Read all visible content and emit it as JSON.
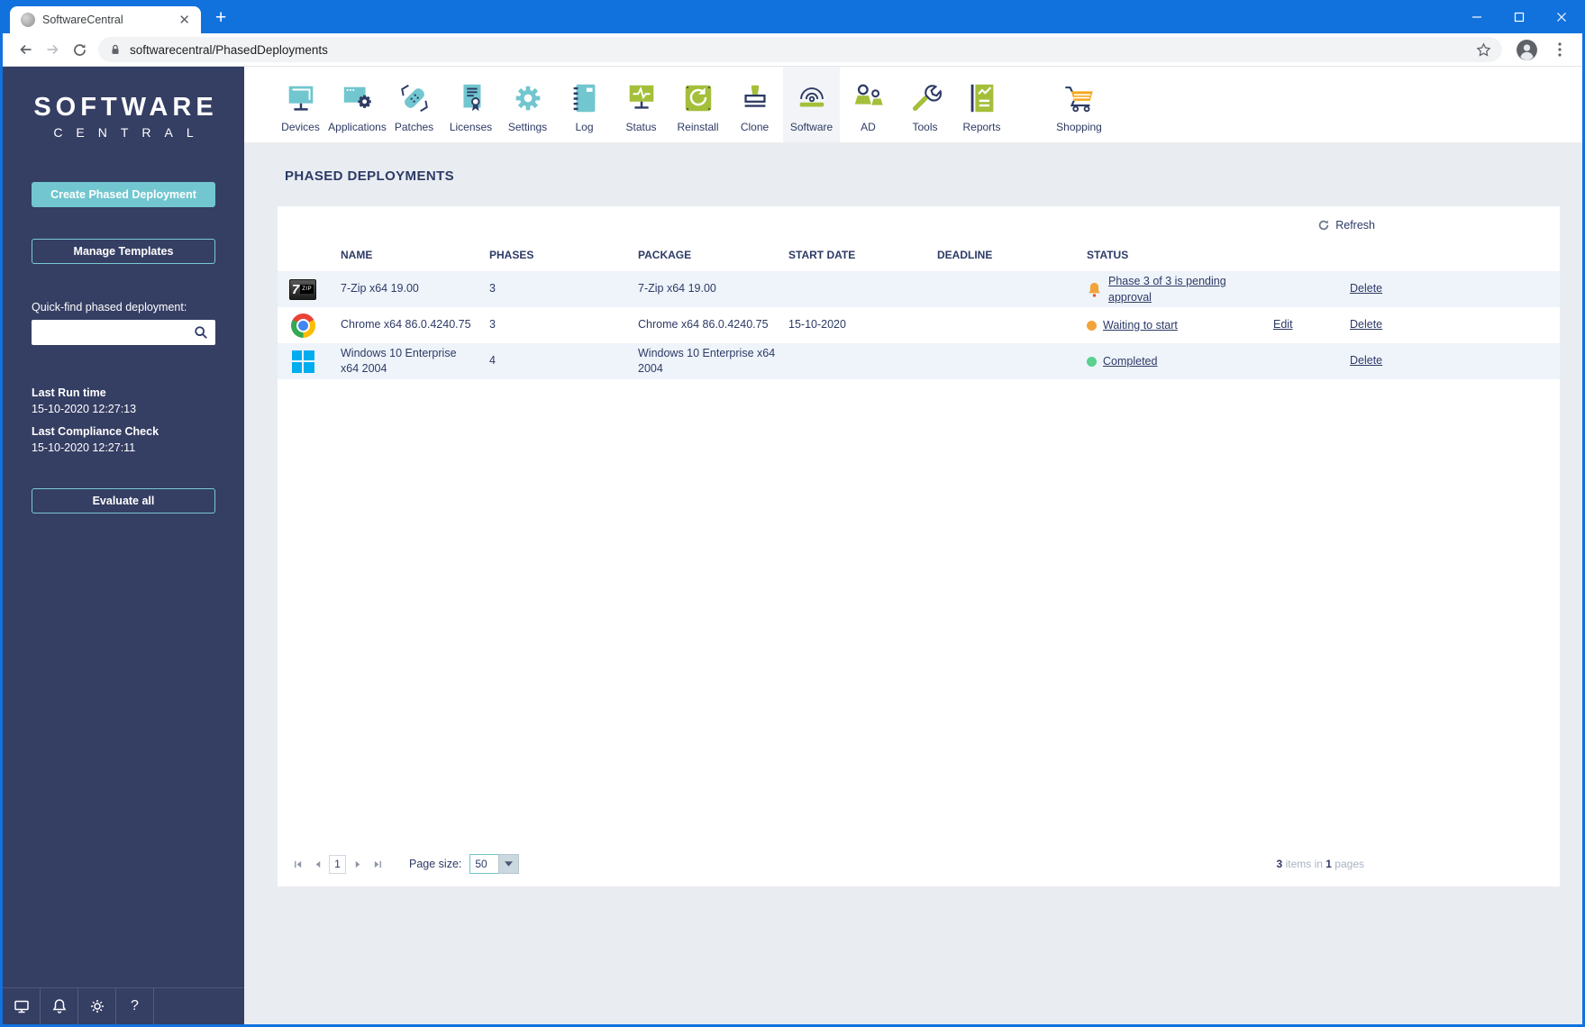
{
  "colors": {
    "titlebar": "#1172de",
    "sidebar": "#353e63",
    "teal": "#71c6cf",
    "olive": "#a4bf3a",
    "navy": "#2d3a64",
    "orange": "#f2a43c",
    "green": "#5bd08f",
    "main_bg": "#e9edf2",
    "alt_row": "#eff4fa",
    "windows_blue": "#00adef"
  },
  "browser": {
    "tab_title": "SoftwareCentral",
    "url": "softwarecentral/PhasedDeployments"
  },
  "sidebar": {
    "logo_line1": "SOFTWARE",
    "logo_line2": "CENTRAL",
    "create_button": "Create Phased Deployment",
    "manage_button": "Manage Templates",
    "quickfind_label": "Quick-find phased deployment:",
    "quickfind_value": "",
    "last_run_label": "Last Run time",
    "last_run_value": "15-10-2020 12:27:13",
    "last_compliance_label": "Last Compliance Check",
    "last_compliance_value": "15-10-2020 12:27:11",
    "evaluate_button": "Evaluate all"
  },
  "nav": {
    "items": [
      {
        "label": "Devices",
        "icon": "devices"
      },
      {
        "label": "Applications",
        "icon": "applications"
      },
      {
        "label": "Patches",
        "icon": "patches"
      },
      {
        "label": "Licenses",
        "icon": "licenses"
      },
      {
        "label": "Settings",
        "icon": "settings"
      },
      {
        "label": "Log",
        "icon": "log"
      },
      {
        "label": "Status",
        "icon": "status"
      },
      {
        "label": "Reinstall",
        "icon": "reinstall"
      },
      {
        "label": "Clone",
        "icon": "clone"
      },
      {
        "label": "Software",
        "icon": "software",
        "active": true
      },
      {
        "label": "AD",
        "icon": "ad"
      },
      {
        "label": "Tools",
        "icon": "tools"
      },
      {
        "label": "Reports",
        "icon": "reports"
      },
      {
        "label": "Shopping",
        "icon": "shopping",
        "gap": true
      }
    ]
  },
  "main": {
    "title": "PHASED DEPLOYMENTS",
    "refresh_label": "Refresh",
    "table": {
      "columns": [
        "NAME",
        "PHASES",
        "PACKAGE",
        "START DATE",
        "DEADLINE",
        "STATUS"
      ],
      "rows": [
        {
          "icon": "sevenzip",
          "name": "7-Zip x64 19.00",
          "phases": "3",
          "package": "7-Zip x64 19.00",
          "start_date": "",
          "deadline": "",
          "status_text": "Phase 3 of 3 is pending approval",
          "status_icon": "bell",
          "edit_label": "",
          "delete_label": "Delete"
        },
        {
          "icon": "chrome",
          "name": "Chrome x64 86.0.4240.75",
          "phases": "3",
          "package": "Chrome x64 86.0.4240.75",
          "start_date": "15-10-2020",
          "deadline": "",
          "status_text": "Waiting to start",
          "status_icon": "dot-orange",
          "edit_label": "Edit",
          "delete_label": "Delete"
        },
        {
          "icon": "windows",
          "name": "Windows 10 Enterprise x64 2004",
          "phases": "4",
          "package": "Windows 10 Enterprise x64 2004",
          "start_date": "",
          "deadline": "",
          "status_text": "Completed",
          "status_icon": "dot-green",
          "edit_label": "",
          "delete_label": "Delete"
        }
      ]
    },
    "pagination": {
      "current_page": "1",
      "page_size_label": "Page size:",
      "page_size_value": "50",
      "summary": {
        "count": "3",
        "items_text": "items in",
        "pages_count": "1",
        "pages_text": "pages"
      }
    }
  }
}
